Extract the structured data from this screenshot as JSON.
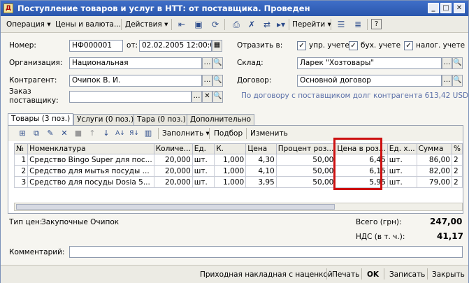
{
  "title": "Поступление товаров и услуг в НТТ: от поставщика. Проведен",
  "toolbar": {
    "operation": "Операция",
    "prices": "Цены и валюта...",
    "actions": "Действия",
    "goto": "Перейти",
    "help": "?"
  },
  "form": {
    "number_label": "Номер:",
    "number_value": "НФ000001",
    "from_label": "от:",
    "date_value": "02.02.2005 12:00:00",
    "reflect_label": "Отразить в:",
    "reflect_mgmt": "упр. учете",
    "reflect_acc": "бух. учете",
    "reflect_tax": "налог. учете",
    "org_label": "Организация:",
    "org_value": "Национальная",
    "warehouse_label": "Склад:",
    "warehouse_value": "Ларек \"Хозтовары\"",
    "contractor_label": "Контрагент:",
    "contractor_value": "Очипок В. И.",
    "contract_label": "Договор:",
    "contract_value": "Основной договор",
    "order_label_1": "Заказ",
    "order_label_2": "поставщику:",
    "order_value": "",
    "debt_text": "По договору с поставщиком долг контрагента 613,42 USD"
  },
  "tabs": [
    "Товары (3 поз.)",
    "Услуги (0 поз.)",
    "Тара (0 поз.)",
    "Дополнительно"
  ],
  "grid_toolbar": {
    "fill": "Заполнить",
    "select": "Подбор",
    "change": "Изменить"
  },
  "grid": {
    "columns": [
      "№",
      "Номенклатура",
      "Количе...",
      "Ед.",
      "К.",
      "Цена",
      "Процент роз...",
      "Цена в роз...",
      "Ед. х...",
      "Сумма",
      "%"
    ],
    "rows": [
      [
        "1",
        "Средство Bingo Super для пос...",
        "20,000",
        "шт.",
        "1,000",
        "4,30",
        "50,00",
        "6,45",
        "шт.",
        "86,00",
        "2"
      ],
      [
        "2",
        "Средство для мытья посуды ...",
        "20,000",
        "шт.",
        "1,000",
        "4,10",
        "50,00",
        "6,15",
        "шт.",
        "82,00",
        "2"
      ],
      [
        "3",
        "Средство для посуды Dosia 5...",
        "20,000",
        "шт.",
        "1,000",
        "3,95",
        "50,00",
        "5,95",
        "шт.",
        "79,00",
        "2"
      ]
    ]
  },
  "summary": {
    "price_type_label": "Тип цен:",
    "price_type_value": "Закупочные Очипок",
    "total_label": "Всего (грн):",
    "total_value": "247,00",
    "vat_label": "НДС (в т. ч.):",
    "vat_value": "41,17",
    "comment_label": "Комментарий:",
    "comment_value": ""
  },
  "footer": {
    "invoice": "Приходная накладная с наценкой",
    "print": "Печать",
    "ok": "OK",
    "save": "Записать",
    "close": "Закрыть"
  },
  "colors": {
    "title_bar": "#2a56ad",
    "highlight": "#cc1111",
    "debt_text": "#5a6fa8"
  }
}
